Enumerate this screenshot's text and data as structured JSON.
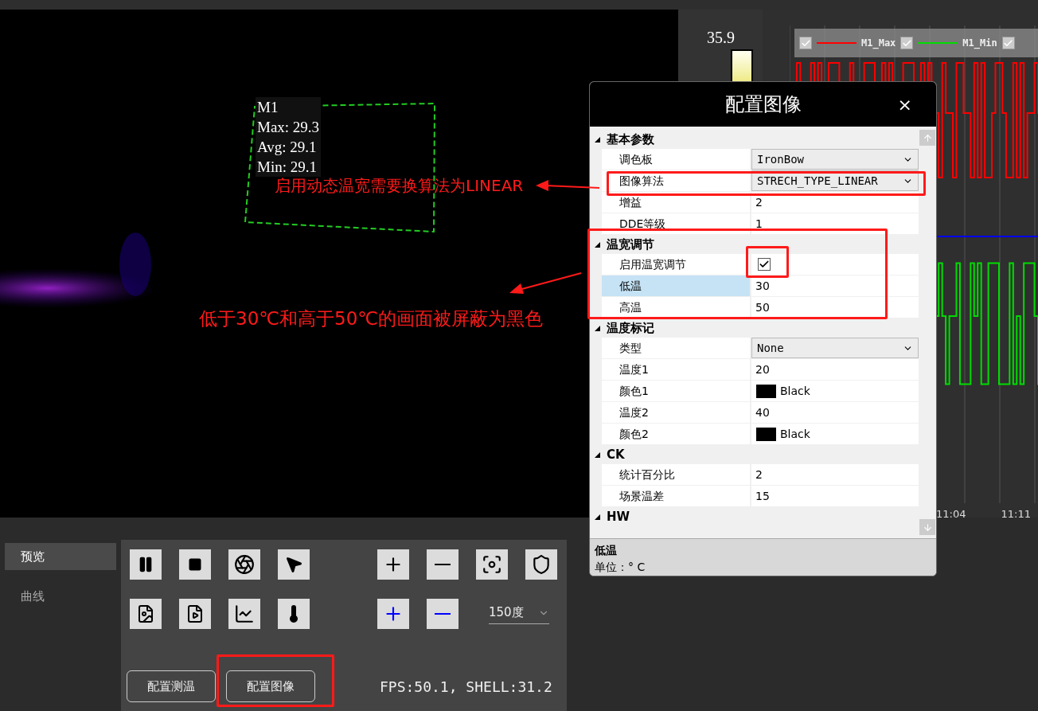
{
  "video": {
    "roi": {
      "lines": [
        "M1",
        "Max: 29.3",
        "Avg: 29.1",
        "Min: 29.1"
      ]
    }
  },
  "color_bar": {
    "max": "35.9"
  },
  "chart": {
    "legend": [
      {
        "label": "M1_Max",
        "checked": true,
        "color": "#ff0000"
      },
      {
        "label": "M1_Min",
        "checked": true,
        "color": "#00dd00"
      },
      {
        "checked": true
      }
    ],
    "x_labels": [
      "11:04",
      "11:11"
    ]
  },
  "dialog": {
    "title": "配置图像",
    "close": "×",
    "sections": [
      {
        "title": "基本参数",
        "expanded": true,
        "rows": [
          {
            "label": "调色板",
            "kind": "dropdown",
            "value": "IronBow",
            "selected": false
          },
          {
            "label": "图像算法",
            "kind": "dropdown",
            "value": "STRECH_TYPE_LINEAR",
            "selected": false
          },
          {
            "label": "增益",
            "kind": "text",
            "value": "2",
            "selected": false
          },
          {
            "label": "DDE等级",
            "kind": "text",
            "value": "1",
            "selected": false
          }
        ]
      },
      {
        "title": "温宽调节",
        "expanded": true,
        "rows": [
          {
            "label": "启用温宽调节",
            "kind": "checkbox",
            "checked": true,
            "selected": false
          },
          {
            "label": "低温",
            "kind": "text",
            "value": "30",
            "selected": true
          },
          {
            "label": "高温",
            "kind": "text",
            "value": "50",
            "selected": false
          }
        ]
      },
      {
        "title": "温度标记",
        "expanded": true,
        "rows": [
          {
            "label": "类型",
            "kind": "dropdown",
            "value": "None",
            "selected": false
          },
          {
            "label": "温度1",
            "kind": "text",
            "value": "20",
            "selected": false
          },
          {
            "label": "颜色1",
            "kind": "color",
            "value": "Black",
            "color": "#000000",
            "selected": false
          },
          {
            "label": "温度2",
            "kind": "text",
            "value": "40",
            "selected": false
          },
          {
            "label": "颜色2",
            "kind": "color",
            "value": "Black",
            "color": "#000000",
            "selected": false
          }
        ]
      },
      {
        "title": "CK",
        "expanded": true,
        "rows": [
          {
            "label": "统计百分比",
            "kind": "text",
            "value": "2",
            "selected": false
          },
          {
            "label": "场景温差",
            "kind": "text",
            "value": "15",
            "selected": false
          }
        ]
      },
      {
        "title": "HW",
        "expanded": true
      }
    ],
    "description": {
      "title": "低温",
      "text": "单位：° C"
    }
  },
  "nav": [
    {
      "label": "预览",
      "selected": true
    },
    {
      "label": "曲线",
      "selected": false
    }
  ],
  "controls": {
    "range": "150度",
    "buttons": [
      "配置测温",
      "配置图像"
    ],
    "status": "FPS:50.1, SHELL:31.2"
  },
  "annotations": [
    "启用动态温宽需要换算法为LINEAR",
    "低于30℃和高于50℃的画面被屏蔽为黑色"
  ]
}
